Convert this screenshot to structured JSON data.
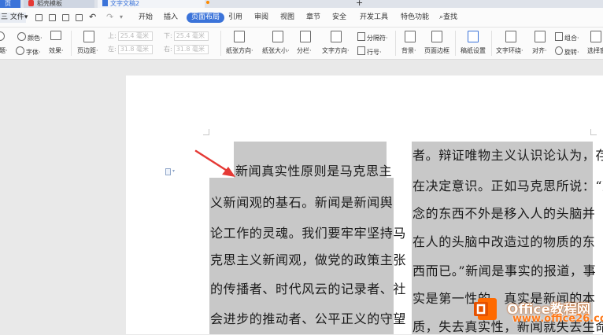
{
  "tabs": {
    "home": "页",
    "template": "稻壳模板",
    "document": "文字文稿2",
    "new_tab": "+"
  },
  "menubar": {
    "file": "三 文件",
    "file_caret": "▾",
    "items": [
      "开始",
      "插入",
      "页面布局",
      "引用",
      "审阅",
      "视图",
      "章节",
      "安全",
      "开发工具",
      "特色功能"
    ],
    "active": "页面布局",
    "search": "查找"
  },
  "ribbon": {
    "left_top": "颜色·",
    "left_bottom_a": "字体·",
    "left_bottom_b": "效果·",
    "left_misc": "题·",
    "margin": "页边距·",
    "top_label": "上:",
    "top_value": "25.4 毫米",
    "bottom_label": "下:",
    "bottom_value": "25.4 毫米",
    "left_label": "左:",
    "left_value": "31.8 毫米",
    "right_label": "右:",
    "right_value": "31.8 毫米",
    "orientation": "纸张方向·",
    "size": "纸张大小·",
    "columns": "分栏·",
    "text_direction": "文字方向·",
    "breaks": "分隔符·",
    "line_numbers": "行号·",
    "background": "背景·",
    "page_border": "页面边框",
    "draft_settings": "稿纸设置",
    "text_wrap": "文字环绕·",
    "align": "对齐·",
    "group": "组合·",
    "rotate": "旋转·",
    "selection_pane": "选择窗"
  },
  "document": {
    "left_column": [
      "新闻真实性原则是马克思主",
      "义新闻观的基石。新闻是新闻舆",
      "论工作的灵魂。我们要牢牢坚持马",
      "克思主义新闻观，做党的政策主张",
      "的传播者、时代风云的记录者、社",
      "会进步的推动者、公平正义的守望"
    ],
    "right_column": [
      "者。辩证唯物主义认识论认为，存",
      "在决定意识。正如马克思所说：“观",
      "念的东西不外是移入人的头脑并",
      "在人的头脑中改造过的物质的东",
      "西而已。”新闻是事实的报道，事",
      "实是第一性的，真实是新闻的本",
      "质，失去真实性，新闻就失去生命。"
    ]
  },
  "watermark": {
    "brand": "Office教程网",
    "site": "www.office26.com"
  },
  "colors": {
    "accent": "#3b73d9",
    "selection": "#c8c8c8",
    "arrow": "#e53935",
    "watermark_orange": "#ff7a1a"
  }
}
